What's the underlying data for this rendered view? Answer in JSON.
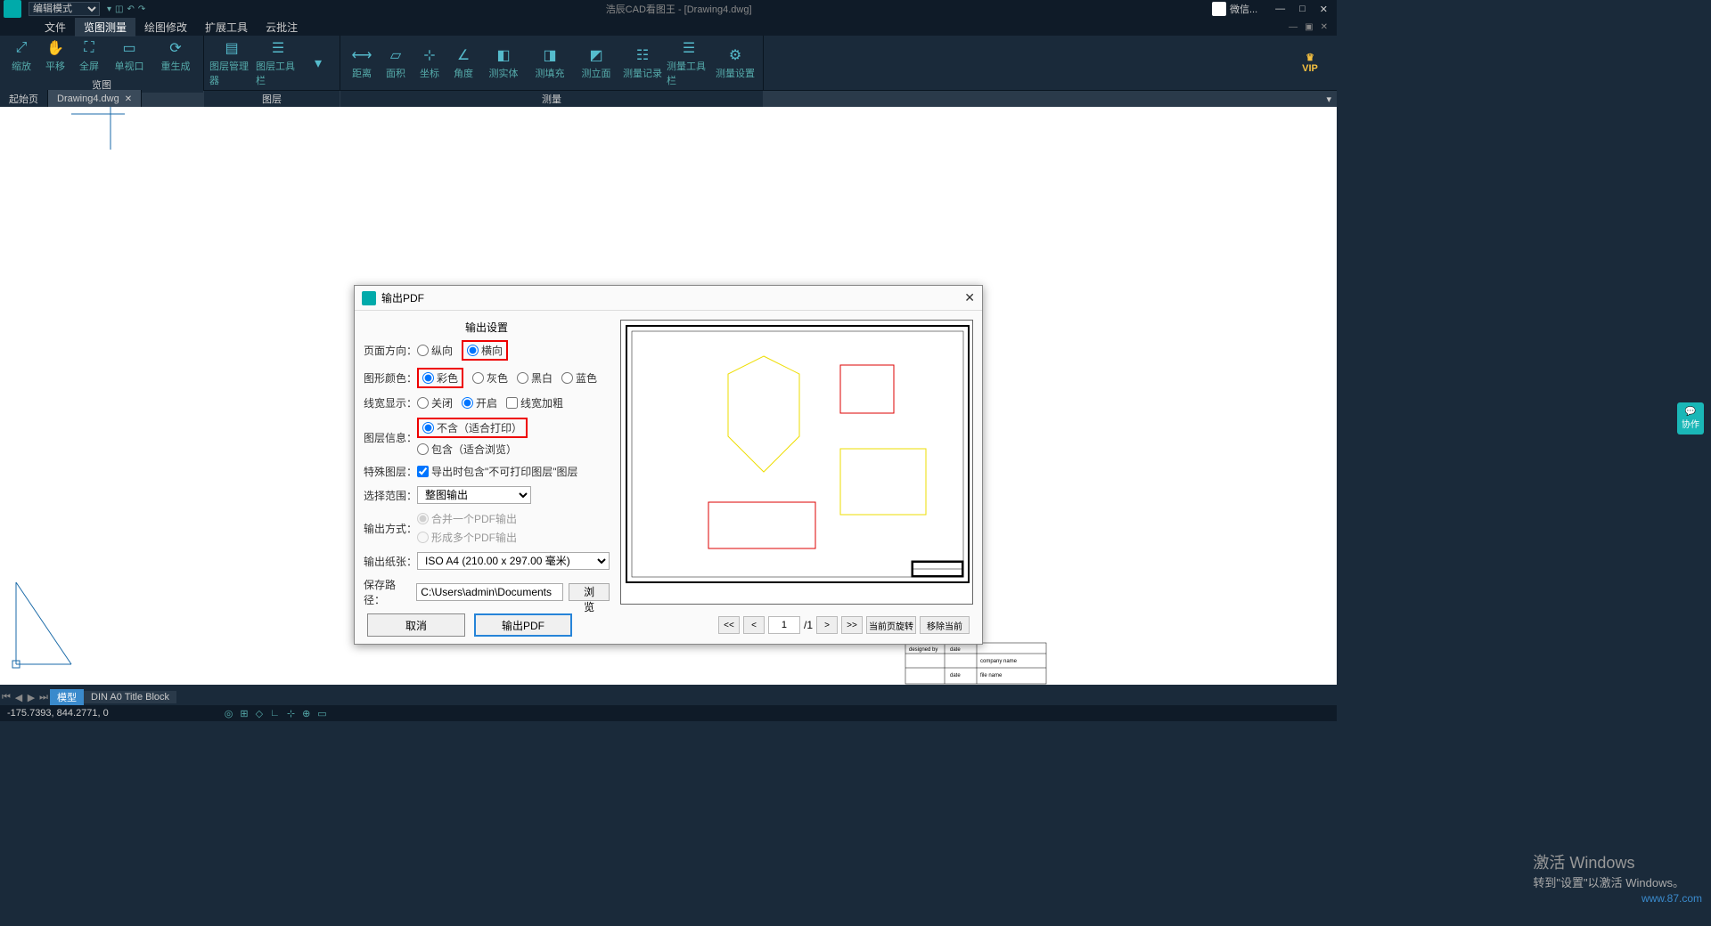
{
  "titlebar": {
    "mode": "编辑模式",
    "app_title": "浩辰CAD看图王 - [Drawing4.dwg]",
    "wechat": "微信...",
    "win_minimize": "—",
    "win_maximize": "□",
    "win_close": "✕"
  },
  "menubar": {
    "items": [
      "文件",
      "览图测量",
      "绘图修改",
      "扩展工具",
      "云批注"
    ],
    "active_index": 1
  },
  "ribbon": {
    "groups": [
      {
        "label": "览图",
        "items": [
          {
            "name": "zoom",
            "label": "缩放",
            "glyph": "⤢"
          },
          {
            "name": "pan",
            "label": "平移",
            "glyph": "✋"
          },
          {
            "name": "fullscreen",
            "label": "全屏",
            "glyph": "⛶"
          },
          {
            "name": "single-viewport",
            "label": "单视口",
            "glyph": "▭"
          },
          {
            "name": "regenerate",
            "label": "重生成",
            "glyph": "⟳"
          }
        ]
      },
      {
        "label": "图层",
        "items": [
          {
            "name": "layer-manager",
            "label": "图层管理器",
            "glyph": "▤"
          },
          {
            "name": "layer-toolbar",
            "label": "图层工具栏",
            "glyph": "☰"
          },
          {
            "name": "layer-more",
            "label": "",
            "glyph": "▾"
          }
        ]
      },
      {
        "label": "测量",
        "items": [
          {
            "name": "distance",
            "label": "距离",
            "glyph": "⟷"
          },
          {
            "name": "area",
            "label": "面积",
            "glyph": "▱"
          },
          {
            "name": "coord",
            "label": "坐标",
            "glyph": "⊹"
          },
          {
            "name": "angle",
            "label": "角度",
            "glyph": "∠"
          },
          {
            "name": "measure-entity",
            "label": "测实体",
            "glyph": "◧"
          },
          {
            "name": "measure-fill",
            "label": "测填充",
            "glyph": "◨"
          },
          {
            "name": "measure-elevation",
            "label": "测立面",
            "glyph": "◩"
          },
          {
            "name": "measure-record",
            "label": "测量记录",
            "glyph": "☷"
          },
          {
            "name": "measure-toolbar",
            "label": "测量工具栏",
            "glyph": "☰"
          },
          {
            "name": "measure-settings",
            "label": "测量设置",
            "glyph": "⚙"
          }
        ]
      }
    ],
    "vip": "VIP"
  },
  "doc_tabs": {
    "tabs": [
      {
        "label": "起始页",
        "closable": false
      },
      {
        "label": "Drawing4.dwg",
        "closable": true
      }
    ],
    "active_index": 1
  },
  "dialog": {
    "title": "输出PDF",
    "section_title": "输出设置",
    "labels": {
      "orient": "页面方向：",
      "color": "图形颜色：",
      "linewidth": "线宽显示：",
      "layerinfo": "图层信息：",
      "special": "特殊图层：",
      "range": "选择范围：",
      "output_mode": "输出方式：",
      "paper": "输出纸张：",
      "save_path": "保存路径："
    },
    "orient": {
      "portrait": "纵向",
      "landscape": "横向"
    },
    "color": {
      "color": "彩色",
      "gray": "灰色",
      "bw": "黑白",
      "blue": "蓝色"
    },
    "linewidth": {
      "off": "关闭",
      "on": "开启",
      "bold": "线宽加粗"
    },
    "layerinfo": {
      "exclude": "不含（适合打印）",
      "include": "包含（适合浏览）"
    },
    "special_checkbox": "导出时包含\"不可打印图层\"图层",
    "range_value": "整图输出",
    "output_mode": {
      "merge": "合并一个PDF输出",
      "split": "形成多个PDF输出"
    },
    "paper_value": "ISO A4 (210.00 x 297.00 毫米)",
    "save_path_value": "C:\\Users\\admin\\Documents",
    "browse": "浏览",
    "cancel": "取消",
    "export": "输出PDF",
    "pager": {
      "first": "<<",
      "prev": "<",
      "page": "1",
      "total": "/1",
      "next": ">",
      "last": ">>",
      "rotate": "当前页旋转",
      "remove": "移除当前"
    }
  },
  "layout_tabs": {
    "active": "模型",
    "layouts": [
      "DIN A0 Title Block"
    ]
  },
  "status": {
    "coords": "-175.7393, 844.2771, 0"
  },
  "collab": "协作",
  "watermark": {
    "line1": "激活 Windows",
    "line2": "转到\"设置\"以激活 Windows。"
  },
  "tutorial_wm": "www.87.com"
}
